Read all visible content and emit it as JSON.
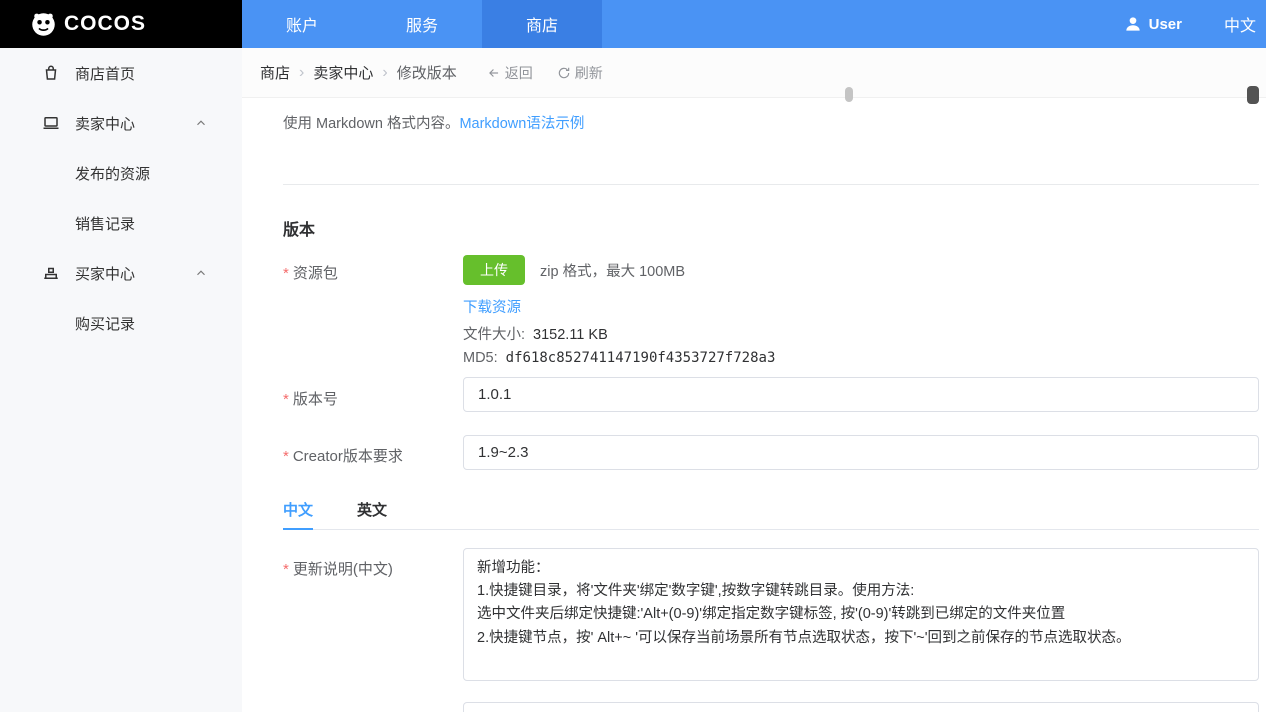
{
  "colors": {
    "navbar_blue": "#4a93f4",
    "navbar_active_blue": "#3a7fe4",
    "link_blue": "#409eff",
    "upload_green": "#66bf2c",
    "required_red": "#f56c6c"
  },
  "navbar": {
    "brand": "COCOS",
    "items": [
      {
        "label": "账户"
      },
      {
        "label": "服务"
      },
      {
        "label": "商店",
        "active": true
      }
    ],
    "user_label": "User",
    "lang_label": "中文"
  },
  "sidebar": {
    "items": [
      {
        "label": "商店首页"
      },
      {
        "label": "卖家中心",
        "expanded": true,
        "children": [
          {
            "label": "发布的资源"
          },
          {
            "label": "销售记录"
          }
        ]
      },
      {
        "label": "买家中心",
        "expanded": true,
        "children": [
          {
            "label": "购买记录"
          }
        ]
      }
    ]
  },
  "breadcrumb": {
    "items": [
      "商店",
      "卖家中心",
      "修改版本"
    ],
    "separator": "›",
    "back_label": "返回",
    "refresh_label": "刷新"
  },
  "form": {
    "required_marker": "*",
    "markdown_hint": "使用 Markdown 格式内容。",
    "markdown_link_label": "Markdown语法示例",
    "section_title": "版本",
    "fields": {
      "package": {
        "label": "资源包",
        "upload_button_label": "上传",
        "format_hint": "zip 格式，最大 100MB",
        "download_link_label": "下载资源",
        "filesize_label": "文件大小:",
        "filesize_value": "3152.11 KB",
        "md5_label": "MD5:",
        "md5_value": "df618c852741147190f4353727f728a3"
      },
      "version": {
        "label": "版本号",
        "value": "1.0.1"
      },
      "creator_version": {
        "label": "Creator版本要求",
        "value": "1.9~2.3"
      },
      "changelog_cn": {
        "label": "更新说明(中文)",
        "value": "新增功能：\n1.快捷键目录，将'文件夹'绑定'数字键',按数字键转跳目录。使用方法:\n选中文件夹后绑定快捷键:'Alt+(0-9)'绑定指定数字键标签, 按'(0-9)'转跳到已绑定的文件夹位置\n2.快捷键节点，按' Alt+~ '可以保存当前场景所有节点选取状态，按下'~'回到之前保存的节点选取状态。"
      }
    },
    "lang_tabs": [
      {
        "label": "中文",
        "active": true
      },
      {
        "label": "英文"
      }
    ]
  }
}
